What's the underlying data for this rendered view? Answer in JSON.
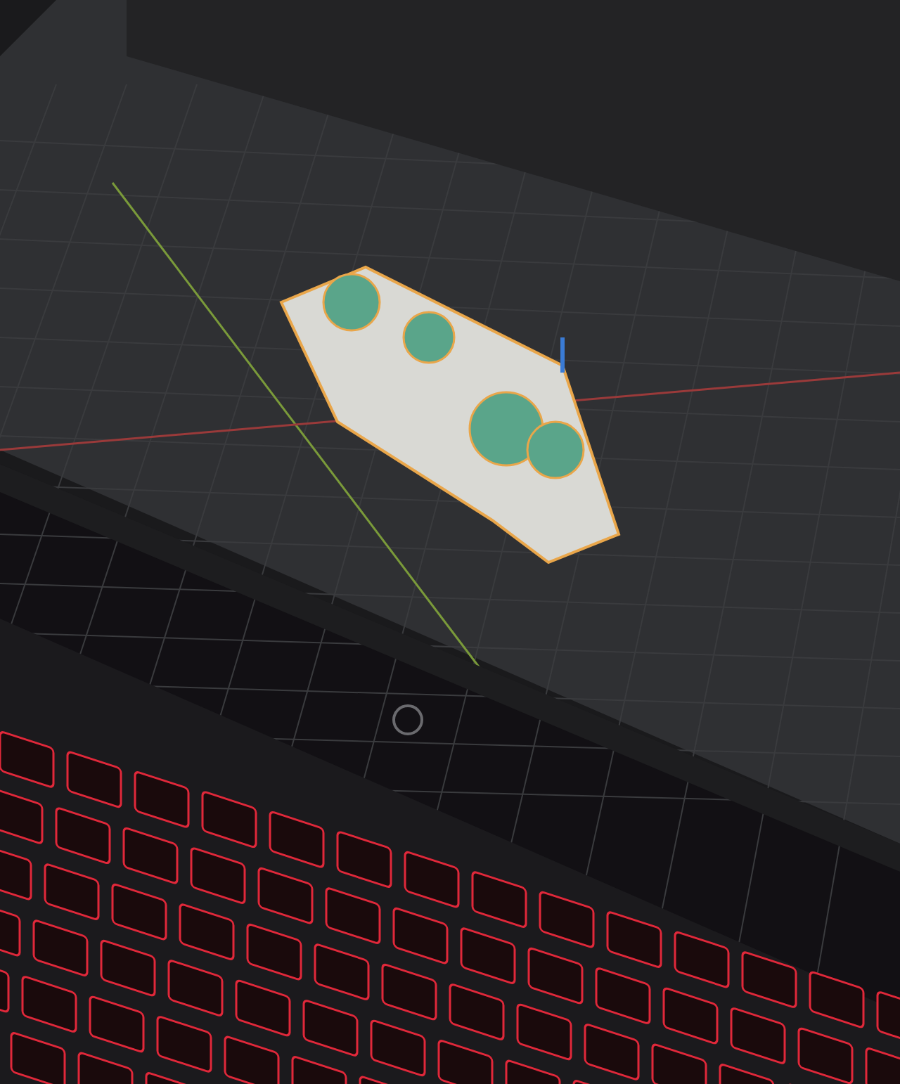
{
  "photo": {
    "kind": "laptop-screen"
  }
}
